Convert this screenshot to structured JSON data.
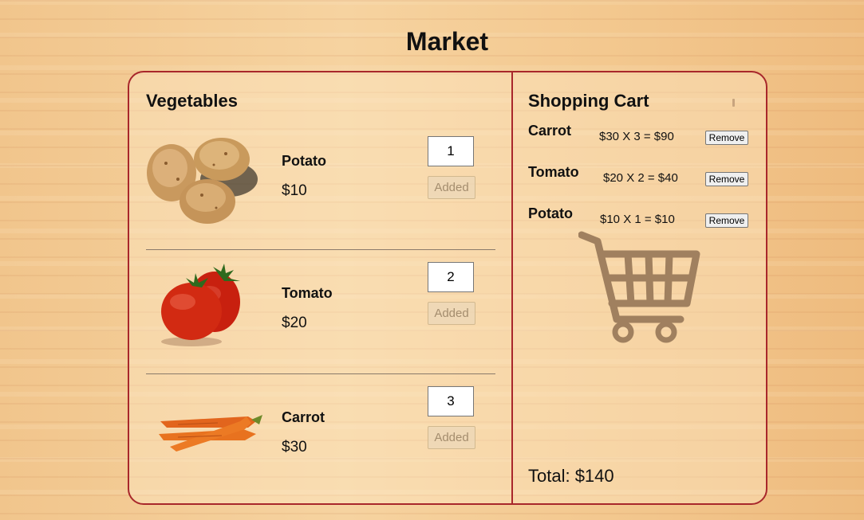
{
  "page": {
    "title": "Market"
  },
  "vegetables": {
    "heading": "Vegetables",
    "items": [
      {
        "name": "Potato",
        "price": "$10",
        "quantity": "1",
        "button_label": "Added",
        "image": "potato-image"
      },
      {
        "name": "Tomato",
        "price": "$20",
        "quantity": "2",
        "button_label": "Added",
        "image": "tomato-image"
      },
      {
        "name": "Carrot",
        "price": "$30",
        "quantity": "3",
        "button_label": "Added",
        "image": "carrot-image"
      }
    ]
  },
  "cart": {
    "heading": "Shopping Cart",
    "rows": [
      {
        "name": "Carrot",
        "calc": "$30 X 3 = $90",
        "remove_label": "Remove"
      },
      {
        "name": "Tomato",
        "calc": "$20 X 2 = $40",
        "remove_label": "Remove"
      },
      {
        "name": "Potato",
        "calc": "$10 X 1 = $10",
        "remove_label": "Remove"
      }
    ],
    "total": "Total: $140",
    "icon": "shopping-cart-icon"
  },
  "colors": {
    "accent_border": "#a8272b",
    "background_wood": "#f3c88f",
    "cart_icon": "#a0805f"
  }
}
